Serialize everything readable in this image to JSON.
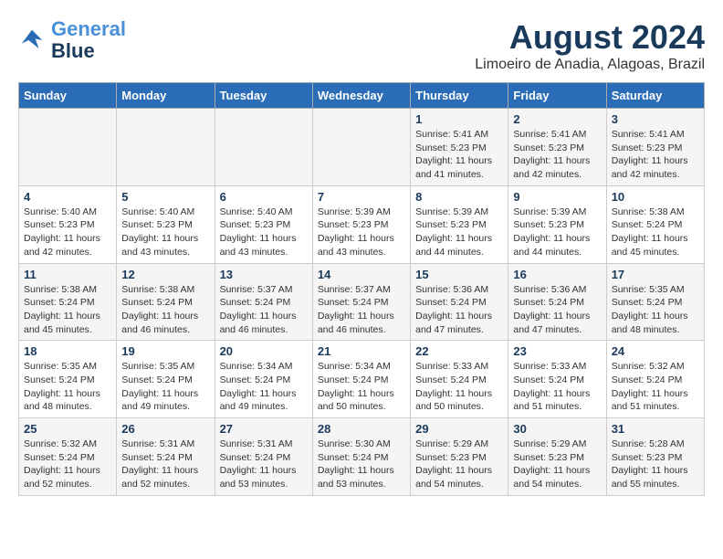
{
  "header": {
    "logo_line1": "General",
    "logo_line2": "Blue",
    "month_year": "August 2024",
    "location": "Limoeiro de Anadia, Alagoas, Brazil"
  },
  "weekdays": [
    "Sunday",
    "Monday",
    "Tuesday",
    "Wednesday",
    "Thursday",
    "Friday",
    "Saturday"
  ],
  "weeks": [
    [
      {
        "day": "",
        "info": ""
      },
      {
        "day": "",
        "info": ""
      },
      {
        "day": "",
        "info": ""
      },
      {
        "day": "",
        "info": ""
      },
      {
        "day": "1",
        "info": "Sunrise: 5:41 AM\nSunset: 5:23 PM\nDaylight: 11 hours\nand 41 minutes."
      },
      {
        "day": "2",
        "info": "Sunrise: 5:41 AM\nSunset: 5:23 PM\nDaylight: 11 hours\nand 42 minutes."
      },
      {
        "day": "3",
        "info": "Sunrise: 5:41 AM\nSunset: 5:23 PM\nDaylight: 11 hours\nand 42 minutes."
      }
    ],
    [
      {
        "day": "4",
        "info": "Sunrise: 5:40 AM\nSunset: 5:23 PM\nDaylight: 11 hours\nand 42 minutes."
      },
      {
        "day": "5",
        "info": "Sunrise: 5:40 AM\nSunset: 5:23 PM\nDaylight: 11 hours\nand 43 minutes."
      },
      {
        "day": "6",
        "info": "Sunrise: 5:40 AM\nSunset: 5:23 PM\nDaylight: 11 hours\nand 43 minutes."
      },
      {
        "day": "7",
        "info": "Sunrise: 5:39 AM\nSunset: 5:23 PM\nDaylight: 11 hours\nand 43 minutes."
      },
      {
        "day": "8",
        "info": "Sunrise: 5:39 AM\nSunset: 5:23 PM\nDaylight: 11 hours\nand 44 minutes."
      },
      {
        "day": "9",
        "info": "Sunrise: 5:39 AM\nSunset: 5:23 PM\nDaylight: 11 hours\nand 44 minutes."
      },
      {
        "day": "10",
        "info": "Sunrise: 5:38 AM\nSunset: 5:24 PM\nDaylight: 11 hours\nand 45 minutes."
      }
    ],
    [
      {
        "day": "11",
        "info": "Sunrise: 5:38 AM\nSunset: 5:24 PM\nDaylight: 11 hours\nand 45 minutes."
      },
      {
        "day": "12",
        "info": "Sunrise: 5:38 AM\nSunset: 5:24 PM\nDaylight: 11 hours\nand 46 minutes."
      },
      {
        "day": "13",
        "info": "Sunrise: 5:37 AM\nSunset: 5:24 PM\nDaylight: 11 hours\nand 46 minutes."
      },
      {
        "day": "14",
        "info": "Sunrise: 5:37 AM\nSunset: 5:24 PM\nDaylight: 11 hours\nand 46 minutes."
      },
      {
        "day": "15",
        "info": "Sunrise: 5:36 AM\nSunset: 5:24 PM\nDaylight: 11 hours\nand 47 minutes."
      },
      {
        "day": "16",
        "info": "Sunrise: 5:36 AM\nSunset: 5:24 PM\nDaylight: 11 hours\nand 47 minutes."
      },
      {
        "day": "17",
        "info": "Sunrise: 5:35 AM\nSunset: 5:24 PM\nDaylight: 11 hours\nand 48 minutes."
      }
    ],
    [
      {
        "day": "18",
        "info": "Sunrise: 5:35 AM\nSunset: 5:24 PM\nDaylight: 11 hours\nand 48 minutes."
      },
      {
        "day": "19",
        "info": "Sunrise: 5:35 AM\nSunset: 5:24 PM\nDaylight: 11 hours\nand 49 minutes."
      },
      {
        "day": "20",
        "info": "Sunrise: 5:34 AM\nSunset: 5:24 PM\nDaylight: 11 hours\nand 49 minutes."
      },
      {
        "day": "21",
        "info": "Sunrise: 5:34 AM\nSunset: 5:24 PM\nDaylight: 11 hours\nand 50 minutes."
      },
      {
        "day": "22",
        "info": "Sunrise: 5:33 AM\nSunset: 5:24 PM\nDaylight: 11 hours\nand 50 minutes."
      },
      {
        "day": "23",
        "info": "Sunrise: 5:33 AM\nSunset: 5:24 PM\nDaylight: 11 hours\nand 51 minutes."
      },
      {
        "day": "24",
        "info": "Sunrise: 5:32 AM\nSunset: 5:24 PM\nDaylight: 11 hours\nand 51 minutes."
      }
    ],
    [
      {
        "day": "25",
        "info": "Sunrise: 5:32 AM\nSunset: 5:24 PM\nDaylight: 11 hours\nand 52 minutes."
      },
      {
        "day": "26",
        "info": "Sunrise: 5:31 AM\nSunset: 5:24 PM\nDaylight: 11 hours\nand 52 minutes."
      },
      {
        "day": "27",
        "info": "Sunrise: 5:31 AM\nSunset: 5:24 PM\nDaylight: 11 hours\nand 53 minutes."
      },
      {
        "day": "28",
        "info": "Sunrise: 5:30 AM\nSunset: 5:24 PM\nDaylight: 11 hours\nand 53 minutes."
      },
      {
        "day": "29",
        "info": "Sunrise: 5:29 AM\nSunset: 5:23 PM\nDaylight: 11 hours\nand 54 minutes."
      },
      {
        "day": "30",
        "info": "Sunrise: 5:29 AM\nSunset: 5:23 PM\nDaylight: 11 hours\nand 54 minutes."
      },
      {
        "day": "31",
        "info": "Sunrise: 5:28 AM\nSunset: 5:23 PM\nDaylight: 11 hours\nand 55 minutes."
      }
    ]
  ]
}
